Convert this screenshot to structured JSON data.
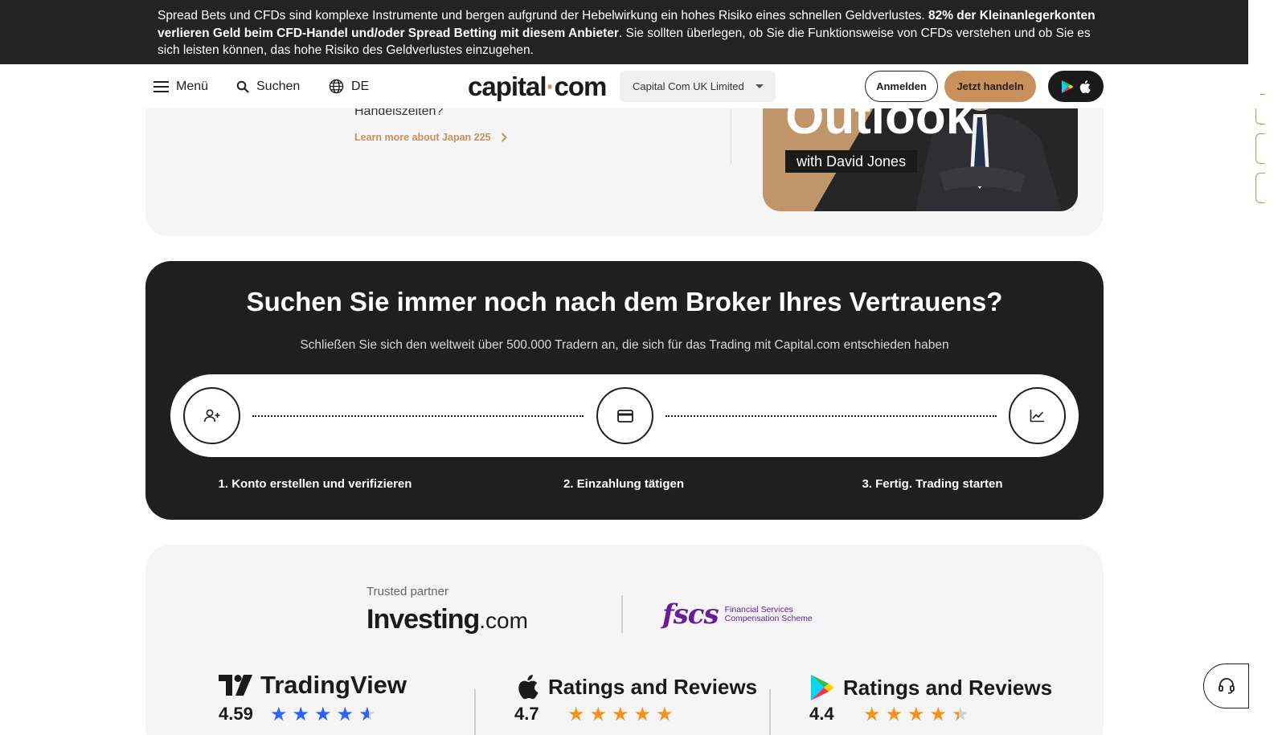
{
  "risk_banner": {
    "text_1": "Spread Bets und CFDs sind komplexe Instrumente und bergen aufgrund der Hebelwirkung ein hohes Risiko eines schnellen Geldverlustes. ",
    "text_bold": "82% der Kleinanlegerkonten verlieren Geld beim CFD-Handel und/oder Spread Betting mit diesem Anbieter",
    "text_2": ". Sie sollten überlegen, ob Sie die Funktionsweise von CFDs verstehen und ob Sie es sich leisten können, das hohe Risiko des Geldverlustes einzugehen."
  },
  "header": {
    "menu_label": "Menü",
    "search_label": "Suchen",
    "language": "DE",
    "logo_left": "capital",
    "logo_dot": "·",
    "logo_right": "com",
    "entity_selected": "Capital Com UK Limited",
    "login_label": "Anmelden",
    "trade_label": "Jetzt handeln"
  },
  "top_card": {
    "question_tail": "Handelszeiten?",
    "learn_more": "Learn more about Japan 225",
    "promo_title": "Outlook",
    "promo_subtitle": "with David Jones"
  },
  "cta": {
    "title": "Suchen Sie immer noch nach dem Broker Ihres Vertrauens?",
    "subtitle": "Schließen Sie sich den weltweit über 500.000 Tradern an, die sich für das Trading mit Capital.com entschieden haben",
    "steps": [
      {
        "label": "1. Konto erstellen und verifizieren",
        "icon": "add-user-icon"
      },
      {
        "label": "2. Einzahlung tätigen",
        "icon": "credit-card-icon"
      },
      {
        "label": "3. Fertig. Trading starten",
        "icon": "chart-line-icon"
      }
    ]
  },
  "partners": {
    "trusted_label": "Trusted partner",
    "investing_name": "Investing",
    "investing_suffix": ".com",
    "fscs_mark": "fscs",
    "fscs_line1": "Financial Services",
    "fscs_line2": "Compensation Scheme"
  },
  "ratings": [
    {
      "source": "TradingView",
      "score": "4.59",
      "stars": 4.59,
      "star_color": "#2962ff"
    },
    {
      "source": "Ratings and Reviews",
      "score": "4.7",
      "stars": 5,
      "star_color": "#f5921b",
      "platform": "apple-icon"
    },
    {
      "source": "Ratings and Reviews",
      "score": "4.4",
      "stars": 4.4,
      "star_color": "#f5921b",
      "platform": "google-play-icon"
    }
  ],
  "colors": {
    "accent": "#c9905a",
    "dark": "#1f1f1f",
    "card_bg": "#f5f5f5"
  }
}
